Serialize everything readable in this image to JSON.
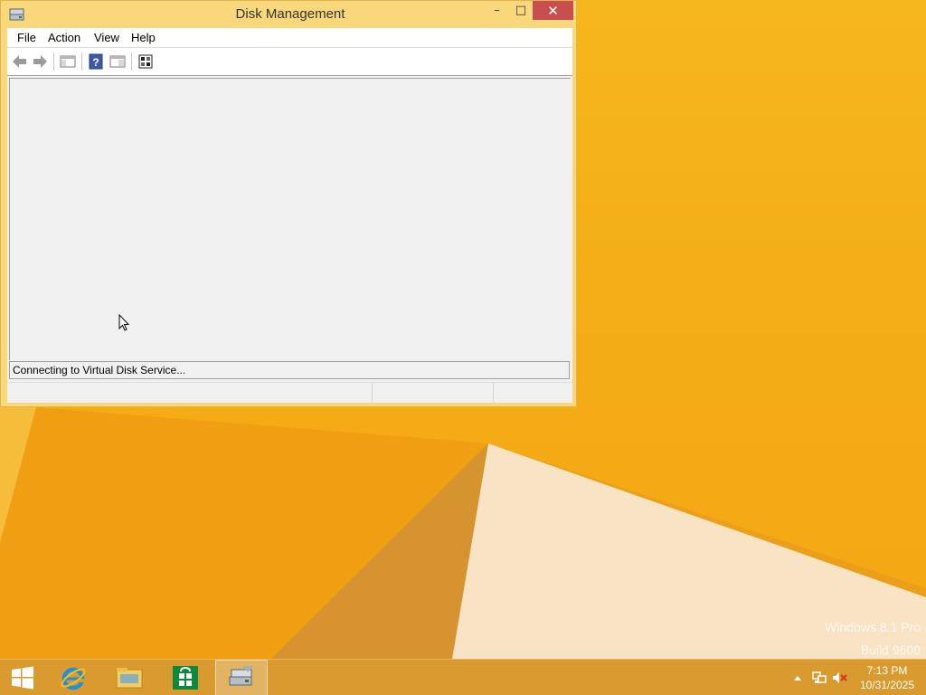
{
  "window": {
    "title": "Disk Management",
    "controls": {
      "minimize": "–",
      "maximize": "□",
      "close": "✕"
    }
  },
  "menubar": {
    "items": [
      "File",
      "Action",
      "View",
      "Help"
    ]
  },
  "toolbar": {
    "buttons": [
      {
        "icon": "back-arrow-icon"
      },
      {
        "icon": "forward-arrow-icon"
      },
      {
        "icon": "console-tree-icon"
      },
      {
        "icon": "help-icon"
      },
      {
        "icon": "properties-pane-icon"
      },
      {
        "icon": "action-pane-icon"
      }
    ]
  },
  "status": {
    "text": "Connecting to Virtual Disk Service..."
  },
  "desktop": {
    "watermark_line1": "Windows 8.1 Pro",
    "watermark_line2": "Build 9600"
  },
  "taskbar": {
    "apps": [
      {
        "name": "start-button",
        "icon": "windows-logo-icon"
      },
      {
        "name": "internet-explorer",
        "icon": "internet-explorer-icon"
      },
      {
        "name": "file-explorer",
        "icon": "folder-icon"
      },
      {
        "name": "store",
        "icon": "store-icon"
      },
      {
        "name": "disk-management",
        "icon": "disk-management-icon",
        "active": true
      }
    ],
    "clock": {
      "time": "7:13 PM",
      "date": "10/31/2025"
    },
    "tray_icons": [
      "chevron-up-icon",
      "network-icon",
      "volume-muted-icon"
    ]
  },
  "colors": {
    "wallpaper": "#f4ad16",
    "window_frame": "#f9d77b",
    "close_button": "#c94f4f",
    "taskbar": "#d99a2f"
  }
}
